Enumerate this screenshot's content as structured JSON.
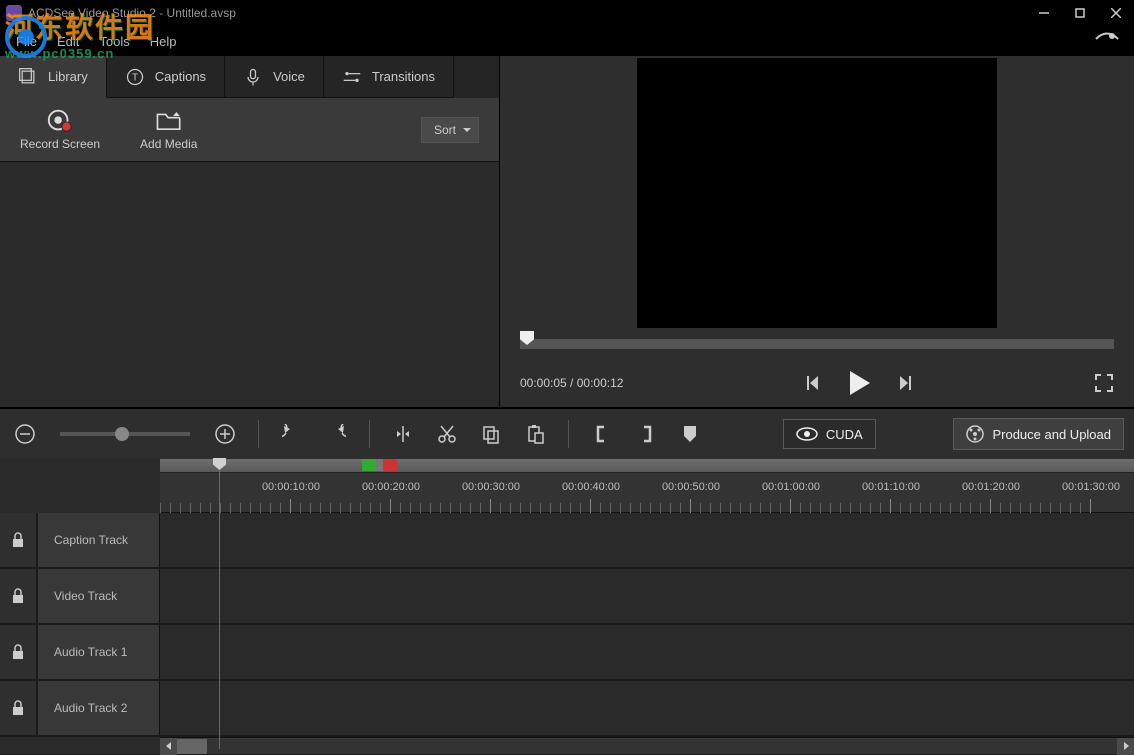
{
  "titlebar": {
    "title": "ACDSee Video Studio 2 - Untitled.avsp"
  },
  "menubar": {
    "items": [
      "File",
      "Edit",
      "Tools",
      "Help"
    ]
  },
  "tabs": {
    "library": "Library",
    "captions": "Captions",
    "voice": "Voice",
    "transitions": "Transitions"
  },
  "toolbar": {
    "record": "Record Screen",
    "add_media": "Add Media",
    "sort": "Sort"
  },
  "preview": {
    "time_current": "00:00:05",
    "time_total": "00:00:12"
  },
  "tlbar": {
    "cuda": "CUDA",
    "produce": "Produce and Upload"
  },
  "ruler": {
    "ticks": [
      "00:00:10:00",
      "00:00:20:00",
      "00:00:30:00",
      "00:00:40:00",
      "00:00:50:00",
      "00:01:00:00",
      "00:01:10:00",
      "00:01:20:00",
      "00:01:30:00"
    ]
  },
  "tracks": {
    "caption": "Caption Track",
    "video": "Video Track",
    "audio1": "Audio Track 1",
    "audio2": "Audio Track 2"
  },
  "watermark": {
    "line1": "河东软件园",
    "line2": "www.pc0359.cn"
  }
}
